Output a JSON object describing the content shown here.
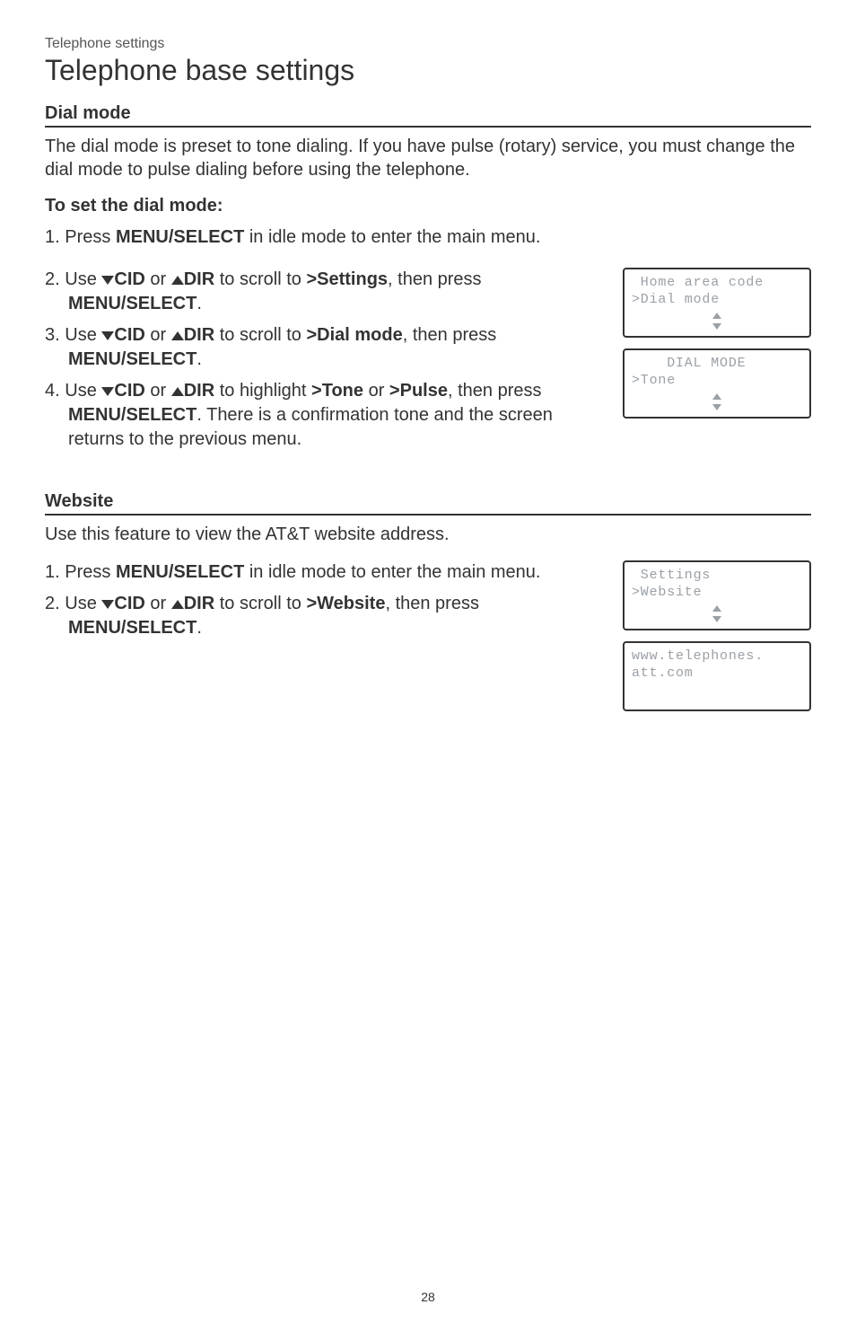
{
  "breadcrumb": "Telephone settings",
  "page_title": "Telephone base settings",
  "dial_mode": {
    "heading": "Dial mode",
    "intro": "The dial mode is preset to tone dialing. If you have pulse (rotary) service, you must change the dial mode to pulse dialing before using the telephone.",
    "sub_heading": "To set the dial mode:",
    "steps": {
      "s1_a": "Press ",
      "s1_b": "MENU/",
      "s1_c": "SELECT",
      "s1_d": " in idle mode to enter the main menu.",
      "s2_a": "Use ",
      "s2_cid": "CID",
      "s2_or": " or ",
      "s2_dir": "DIR",
      "s2_b": " to scroll to ",
      "s2_c": ">Settings",
      "s2_d": ", then press ",
      "s2_menu": "MENU",
      "s2_sel": "/SELECT",
      "s2_e": ".",
      "s3_a": "Use ",
      "s3_b": " to scroll to ",
      "s3_c": ">Dial mode",
      "s3_d": ", then press ",
      "s3_e": ".",
      "s4_a": "Use ",
      "s4_b": " to highlight ",
      "s4_c": ">Tone",
      "s4_or": " or ",
      "s4_d": ">Pulse",
      "s4_e": ", then press ",
      "s4_f": ". There is a confirmation tone and the screen returns to the previous menu."
    },
    "lcd1": {
      "l1": " Home area code",
      "l2": ">Dial mode"
    },
    "lcd2": {
      "l1": "    DIAL MODE",
      "l2": ">Tone"
    }
  },
  "website": {
    "heading": "Website",
    "intro": "Use this feature to view the AT&T website address.",
    "steps": {
      "s1_a": "Press ",
      "s1_b": "MENU/",
      "s1_c": "SELECT",
      "s1_d": " in idle mode to enter the main menu.",
      "s2_a": "Use ",
      "s2_b": " to scroll to ",
      "s2_c": ">Website",
      "s2_d": ", then press ",
      "s2_e": "."
    },
    "lcd1": {
      "l1": " Settings",
      "l2": ">Website"
    },
    "lcd2": {
      "l1": "www.telephones.",
      "l2": "att.com"
    }
  },
  "page_number": "28"
}
